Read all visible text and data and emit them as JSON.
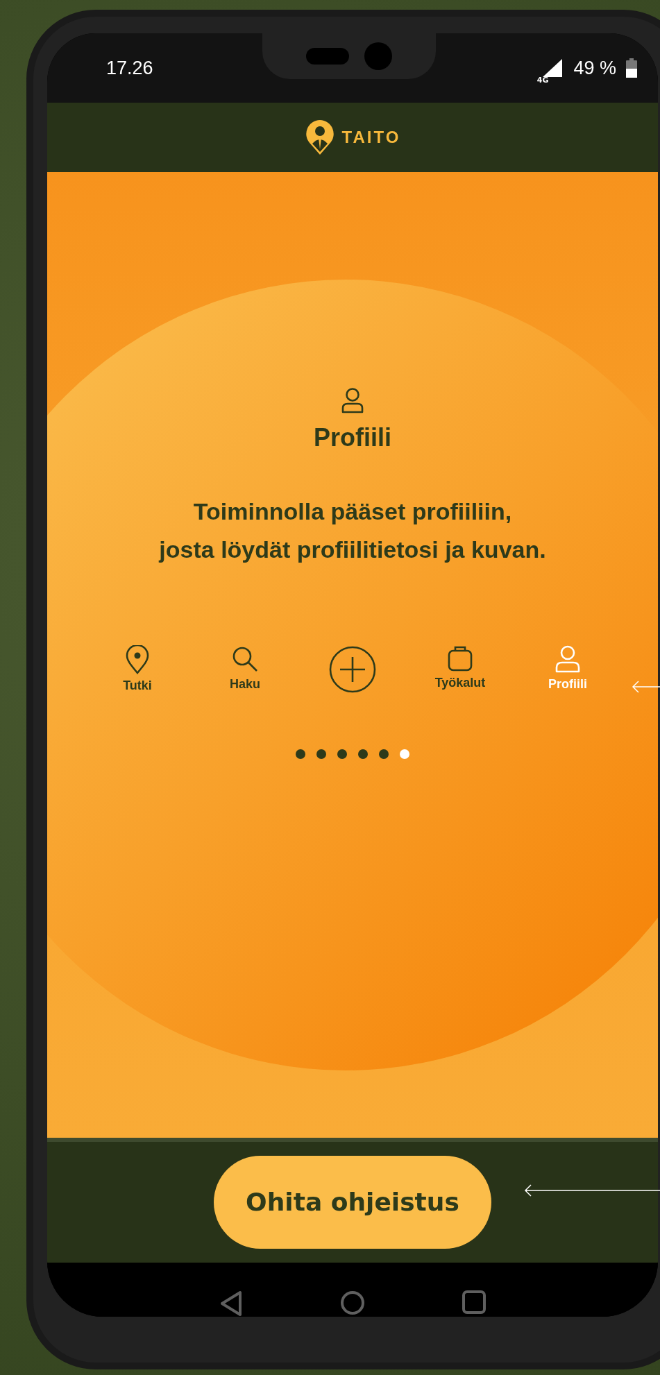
{
  "status_bar": {
    "time": "17.26",
    "network": "4G",
    "battery": "49 %"
  },
  "header": {
    "logo_text": "TAITO"
  },
  "intro": {
    "title": "Profiili",
    "text": "Toiminnolla pääset profiiliin,\njosta löydät profiilitietosi ja kuvan."
  },
  "nav_items": [
    {
      "kind": "pin",
      "label": "Tutki",
      "selected": false
    },
    {
      "kind": "search",
      "label": "Haku",
      "selected": false
    },
    {
      "kind": "plus",
      "selected": false
    },
    {
      "kind": "bag",
      "label": "Työkalut",
      "selected": false
    },
    {
      "kind": "person",
      "label": "Profiili",
      "selected": true
    }
  ],
  "pager_dots": [
    {
      "selected": false
    },
    {
      "selected": false
    },
    {
      "selected": false
    },
    {
      "selected": false
    },
    {
      "selected": false
    },
    {
      "selected": true
    }
  ],
  "skip_button": {
    "label": "Ohita ohjeistus"
  }
}
